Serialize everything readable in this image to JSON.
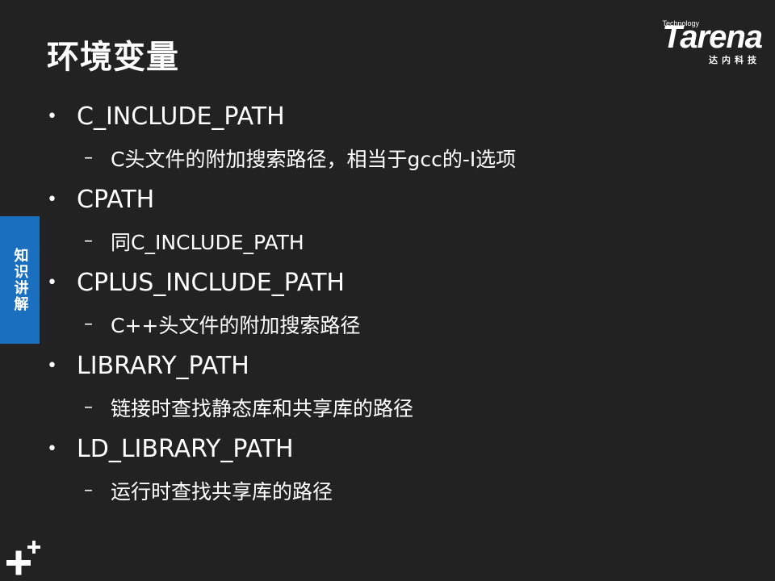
{
  "slide": {
    "title": "环境变量",
    "side_tab": "知识讲解"
  },
  "logo": {
    "small_text": "Technology",
    "brand": "Tarena",
    "chinese": "达内科技"
  },
  "items": [
    {
      "bullet": "•",
      "label": "C_INCLUDE_PATH",
      "dash": "–",
      "sub": "C头文件的附加搜索路径，相当于gcc的-I选项"
    },
    {
      "bullet": "•",
      "label": "CPATH",
      "dash": "–",
      "sub": "同C_INCLUDE_PATH"
    },
    {
      "bullet": "•",
      "label": "CPLUS_INCLUDE_PATH",
      "dash": "–",
      "sub": "C++头文件的附加搜索路径"
    },
    {
      "bullet": "•",
      "label": "LIBRARY_PATH",
      "dash": "–",
      "sub": "链接时查找静态库和共享库的路径"
    },
    {
      "bullet": "•",
      "label": "LD_LIBRARY_PATH",
      "dash": "–",
      "sub": "运行时查找共享库的路径"
    }
  ],
  "colors": {
    "background": "#222222",
    "side_tab": "#1a6fbf",
    "text": "#ffffff"
  },
  "icons": {
    "corner": "plus-plus-icon"
  }
}
